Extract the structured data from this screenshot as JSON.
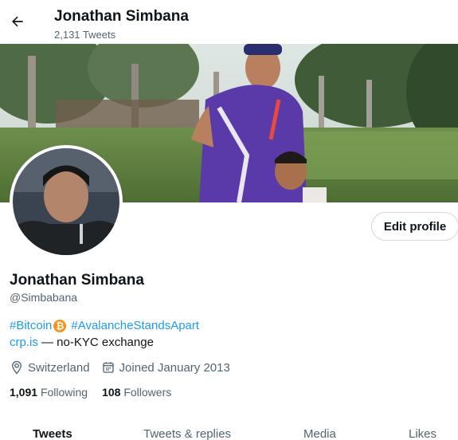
{
  "header": {
    "name": "Jonathan Simbana",
    "tweet_count": "2,131 Tweets"
  },
  "icons": {
    "back": "arrow-left-icon",
    "bitcoin": "bitcoin-icon",
    "location": "location-pin-icon",
    "calendar": "calendar-icon"
  },
  "profile": {
    "edit_label": "Edit profile",
    "name": "Jonathan Simbana",
    "handle": "@Simbabana",
    "bio": {
      "hashtag1": "#Bitcoin",
      "hashtag2": "#AvalancheStandsApart",
      "link": "crp.is",
      "link_suffix": " — no-KYC exchange"
    },
    "location": "Switzerland",
    "joined": "Joined January 2013",
    "following_count": "1,091",
    "following_label": "Following",
    "followers_count": "108",
    "followers_label": "Followers"
  },
  "tabs": [
    {
      "label": "Tweets",
      "active": true
    },
    {
      "label": "Tweets & replies",
      "active": false
    },
    {
      "label": "Media",
      "active": false
    },
    {
      "label": "Likes",
      "active": false
    }
  ],
  "colors": {
    "accent": "#1d9bf0",
    "bitcoin": "#f7931a",
    "secondary_text": "#536471"
  }
}
